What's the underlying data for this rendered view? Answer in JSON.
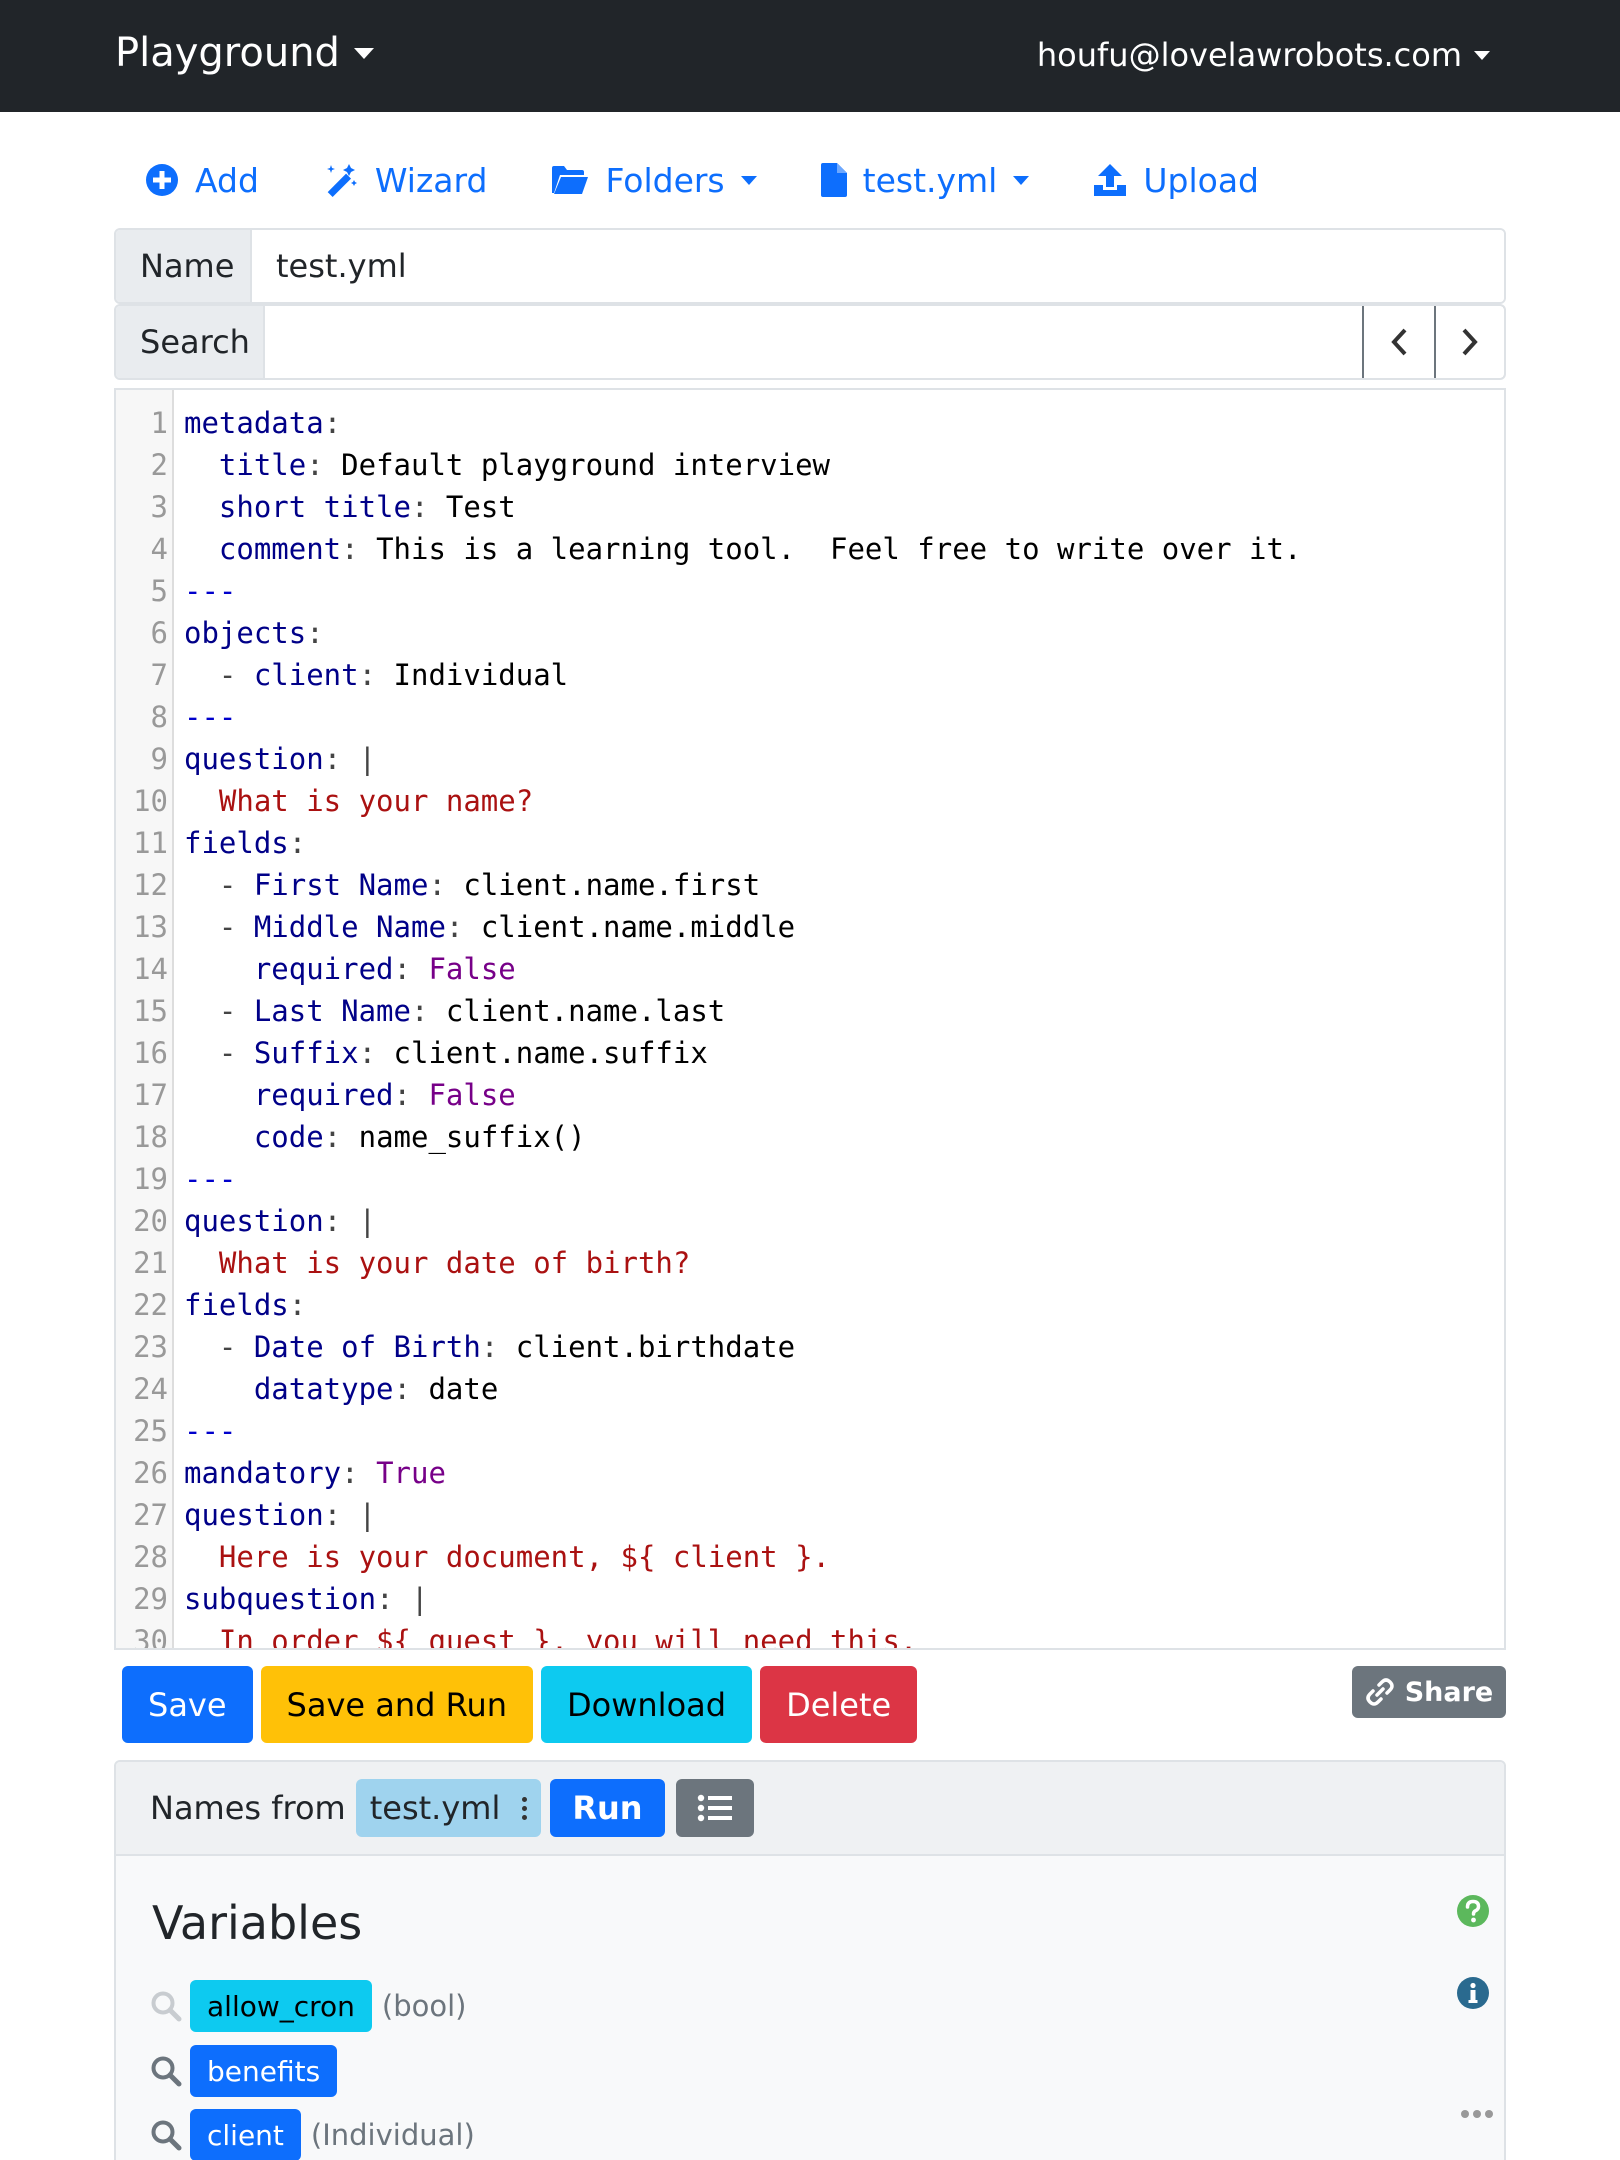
{
  "navbar": {
    "brand": "Playground",
    "user": "houfu@lovelawrobots.com"
  },
  "toolbar": {
    "add": "Add",
    "wizard": "Wizard",
    "folders": "Folders",
    "file": "test.yml",
    "upload": "Upload"
  },
  "name_field": {
    "label": "Name",
    "value": "test.yml"
  },
  "search_field": {
    "label": "Search",
    "value": ""
  },
  "editor": {
    "lines": [
      {
        "n": "1",
        "tokens": [
          [
            "k",
            "metadata"
          ],
          [
            "p",
            ":"
          ]
        ]
      },
      {
        "n": "2",
        "tokens": [
          [
            "v",
            "  "
          ],
          [
            "k",
            "title"
          ],
          [
            "p",
            ": "
          ],
          [
            "v",
            "Default playground interview"
          ]
        ]
      },
      {
        "n": "3",
        "tokens": [
          [
            "v",
            "  "
          ],
          [
            "k",
            "short title"
          ],
          [
            "p",
            ": "
          ],
          [
            "v",
            "Test"
          ]
        ]
      },
      {
        "n": "4",
        "tokens": [
          [
            "v",
            "  "
          ],
          [
            "k",
            "comment"
          ],
          [
            "p",
            ": "
          ],
          [
            "v",
            "This is a learning tool.  Feel free to write over it."
          ]
        ]
      },
      {
        "n": "5",
        "tokens": [
          [
            "d",
            "---"
          ]
        ]
      },
      {
        "n": "6",
        "tokens": [
          [
            "k",
            "objects"
          ],
          [
            "p",
            ":"
          ]
        ]
      },
      {
        "n": "7",
        "tokens": [
          [
            "v",
            "  "
          ],
          [
            "p",
            "- "
          ],
          [
            "k",
            "client"
          ],
          [
            "p",
            ": "
          ],
          [
            "v",
            "Individual"
          ]
        ]
      },
      {
        "n": "8",
        "tokens": [
          [
            "d",
            "---"
          ]
        ]
      },
      {
        "n": "9",
        "tokens": [
          [
            "k",
            "question"
          ],
          [
            "p",
            ": |"
          ]
        ]
      },
      {
        "n": "10",
        "tokens": [
          [
            "s",
            "  What is your name?"
          ]
        ]
      },
      {
        "n": "11",
        "tokens": [
          [
            "k",
            "fields"
          ],
          [
            "p",
            ":"
          ]
        ]
      },
      {
        "n": "12",
        "tokens": [
          [
            "v",
            "  "
          ],
          [
            "p",
            "- "
          ],
          [
            "k",
            "First Name"
          ],
          [
            "p",
            ": "
          ],
          [
            "v",
            "client.name.first"
          ]
        ]
      },
      {
        "n": "13",
        "tokens": [
          [
            "v",
            "  "
          ],
          [
            "p",
            "- "
          ],
          [
            "k",
            "Middle Name"
          ],
          [
            "p",
            ": "
          ],
          [
            "v",
            "client.name.middle"
          ]
        ]
      },
      {
        "n": "14",
        "tokens": [
          [
            "v",
            "    "
          ],
          [
            "k",
            "required"
          ],
          [
            "p",
            ": "
          ],
          [
            "b",
            "False"
          ]
        ]
      },
      {
        "n": "15",
        "tokens": [
          [
            "v",
            "  "
          ],
          [
            "p",
            "- "
          ],
          [
            "k",
            "Last Name"
          ],
          [
            "p",
            ": "
          ],
          [
            "v",
            "client.name.last"
          ]
        ]
      },
      {
        "n": "16",
        "tokens": [
          [
            "v",
            "  "
          ],
          [
            "p",
            "- "
          ],
          [
            "k",
            "Suffix"
          ],
          [
            "p",
            ": "
          ],
          [
            "v",
            "client.name.suffix"
          ]
        ]
      },
      {
        "n": "17",
        "tokens": [
          [
            "v",
            "    "
          ],
          [
            "k",
            "required"
          ],
          [
            "p",
            ": "
          ],
          [
            "b",
            "False"
          ]
        ]
      },
      {
        "n": "18",
        "tokens": [
          [
            "v",
            "    "
          ],
          [
            "k",
            "code"
          ],
          [
            "p",
            ": "
          ],
          [
            "v",
            "name_suffix()"
          ]
        ]
      },
      {
        "n": "19",
        "tokens": [
          [
            "d",
            "---"
          ]
        ]
      },
      {
        "n": "20",
        "tokens": [
          [
            "k",
            "question"
          ],
          [
            "p",
            ": |"
          ]
        ]
      },
      {
        "n": "21",
        "tokens": [
          [
            "s",
            "  What is your date of birth?"
          ]
        ]
      },
      {
        "n": "22",
        "tokens": [
          [
            "k",
            "fields"
          ],
          [
            "p",
            ":"
          ]
        ]
      },
      {
        "n": "23",
        "tokens": [
          [
            "v",
            "  "
          ],
          [
            "p",
            "- "
          ],
          [
            "k",
            "Date of Birth"
          ],
          [
            "p",
            ": "
          ],
          [
            "v",
            "client.birthdate"
          ]
        ]
      },
      {
        "n": "24",
        "tokens": [
          [
            "v",
            "    "
          ],
          [
            "k",
            "datatype"
          ],
          [
            "p",
            ": "
          ],
          [
            "v",
            "date"
          ]
        ]
      },
      {
        "n": "25",
        "tokens": [
          [
            "d",
            "---"
          ]
        ]
      },
      {
        "n": "26",
        "tokens": [
          [
            "k",
            "mandatory"
          ],
          [
            "p",
            ": "
          ],
          [
            "b",
            "True"
          ]
        ]
      },
      {
        "n": "27",
        "tokens": [
          [
            "k",
            "question"
          ],
          [
            "p",
            ": |"
          ]
        ]
      },
      {
        "n": "28",
        "tokens": [
          [
            "s",
            "  Here is your document, ${ client }."
          ]
        ]
      },
      {
        "n": "29",
        "tokens": [
          [
            "k",
            "subquestion"
          ],
          [
            "p",
            ": |"
          ]
        ]
      },
      {
        "n": "30",
        "tokens": [
          [
            "s",
            "  In order ${ quest }, you will need this."
          ]
        ]
      }
    ]
  },
  "actions": {
    "save": "Save",
    "save_and_run": "Save and Run",
    "download": "Download",
    "delete": "Delete",
    "share": "Share"
  },
  "names_panel": {
    "names_from": "Names from",
    "file": "test.yml",
    "run": "Run",
    "variables_title": "Variables",
    "variables": [
      {
        "name": "allow_cron",
        "type": "(bool)"
      },
      {
        "name": "benefits",
        "type": ""
      },
      {
        "name": "client",
        "type": "(Individual)"
      }
    ]
  },
  "colors": {
    "navbar": "#212529",
    "primary": "#0d6efd",
    "warning": "#ffc107",
    "info": "#0dcaf0",
    "danger": "#dc3545",
    "secondary": "#6c757d",
    "success": "#5cb85c"
  },
  "icons": {
    "add": "plus-circle-icon",
    "wizard": "magic-wand-icon",
    "folders": "folder-open-icon",
    "file": "file-icon",
    "upload": "upload-icon",
    "share": "link-icon",
    "list": "list-icon",
    "help": "question-circle-icon",
    "info": "info-circle-icon",
    "search": "magnifier-icon",
    "more": "ellipsis-icon"
  }
}
